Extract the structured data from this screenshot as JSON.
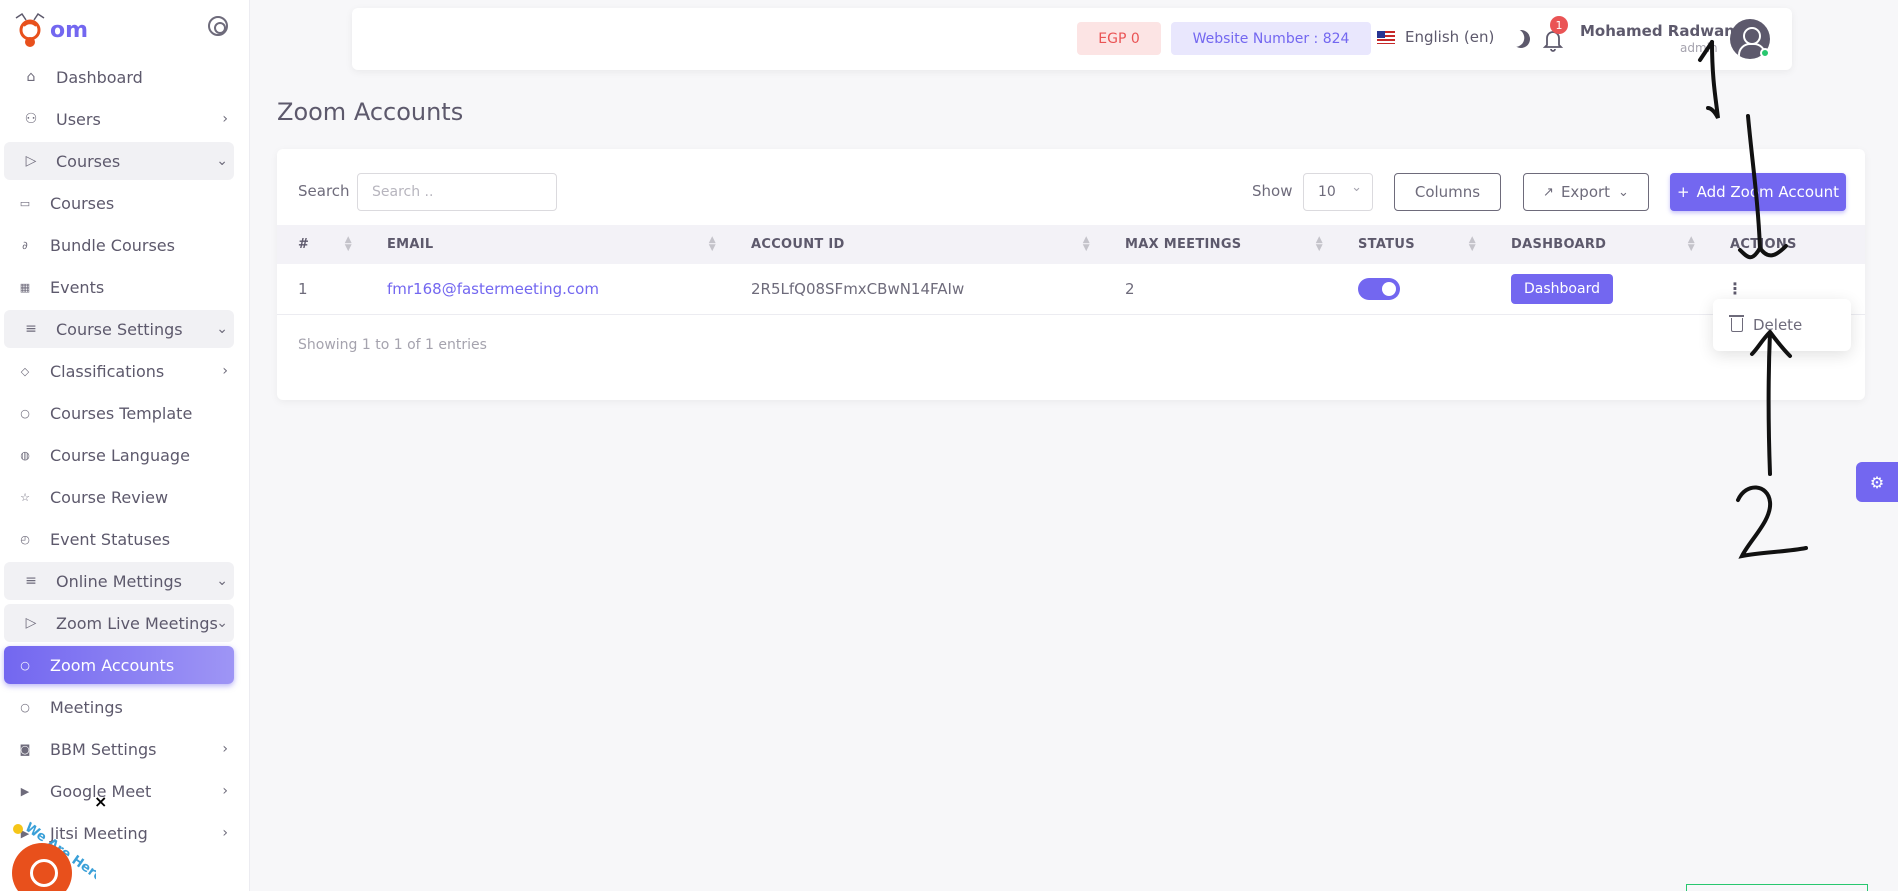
{
  "brand": {
    "logo_text": "om"
  },
  "sidebar": {
    "items": [
      {
        "label": "Dashboard",
        "icon": "home-icon",
        "kind": "top"
      },
      {
        "label": "Users",
        "icon": "users-icon",
        "kind": "top",
        "chevron": "›"
      },
      {
        "label": "Courses",
        "icon": "play-circle-icon",
        "kind": "group",
        "chevron": "⌄"
      },
      {
        "label": "Courses",
        "icon": "book-icon",
        "kind": "sub"
      },
      {
        "label": "Bundle Courses",
        "icon": "paperclip-icon",
        "kind": "sub"
      },
      {
        "label": "Events",
        "icon": "calendar-icon",
        "kind": "sub"
      },
      {
        "label": "Course Settings",
        "icon": "menu-icon",
        "kind": "group",
        "chevron": "⌄"
      },
      {
        "label": "Classifications",
        "icon": "tag-icon",
        "kind": "sub",
        "chevron": "›"
      },
      {
        "label": "Courses Template",
        "icon": "circle-icon",
        "kind": "sub"
      },
      {
        "label": "Course Language",
        "icon": "globe-icon",
        "kind": "sub"
      },
      {
        "label": "Course Review",
        "icon": "star-icon",
        "kind": "sub"
      },
      {
        "label": "Event Statuses",
        "icon": "check-circle-icon",
        "kind": "sub"
      },
      {
        "label": "Online Mettings",
        "icon": "menu-icon",
        "kind": "group",
        "chevron": "⌄"
      },
      {
        "label": "Zoom Live Meetings",
        "icon": "play-icon",
        "kind": "group",
        "chevron": "⌄"
      },
      {
        "label": "Zoom Accounts",
        "icon": "circle-icon",
        "kind": "active"
      },
      {
        "label": "Meetings",
        "icon": "circle-icon",
        "kind": "sub"
      },
      {
        "label": "BBM Settings",
        "icon": "camera-icon",
        "kind": "sub",
        "chevron": "›"
      },
      {
        "label": "Google Meet",
        "icon": "video-icon",
        "kind": "sub",
        "chevron": "›"
      },
      {
        "label": "Jitsi Meeting",
        "icon": "video-icon",
        "kind": "sub",
        "chevron": "›"
      }
    ]
  },
  "header": {
    "balance": "EGP 0",
    "website_number": "Website Number : 824",
    "language": "English (en)",
    "notification_count": "1",
    "user_name": "Mohamed Radwan",
    "user_role": "admin"
  },
  "page": {
    "title": "Zoom Accounts"
  },
  "toolbar": {
    "search_label": "Search",
    "search_placeholder": "Search ..",
    "show_label": "Show",
    "show_value": "10",
    "columns_label": "Columns",
    "export_label": "Export",
    "add_label": "Add Zoom Account"
  },
  "table": {
    "headers": [
      "#",
      "EMAIL",
      "ACCOUNT ID",
      "MAX MEETINGS",
      "STATUS",
      "DASHBOARD",
      "ACTIONS"
    ],
    "rows": [
      {
        "index": "1",
        "email": "fmr168@fastermeeting.com",
        "account_id": "2R5LfQ08SFmxCBwN14FAIw",
        "max_meetings": "2",
        "status_on": true,
        "dashboard_label": "Dashboard",
        "actions_icon": "⋮"
      }
    ],
    "showing": "Showing 1 to 1 of 1 entries"
  },
  "actions_menu": {
    "delete_label": "Delete"
  },
  "annotations": {
    "arrow_1": "1",
    "arrow_2": "2"
  },
  "chat_widget": {
    "close": "×",
    "tag": "We Are Here!"
  },
  "colors": {
    "primary": "#7367f0",
    "danger": "#ea5455",
    "success": "#28c76f",
    "chat": "#e8501c"
  }
}
